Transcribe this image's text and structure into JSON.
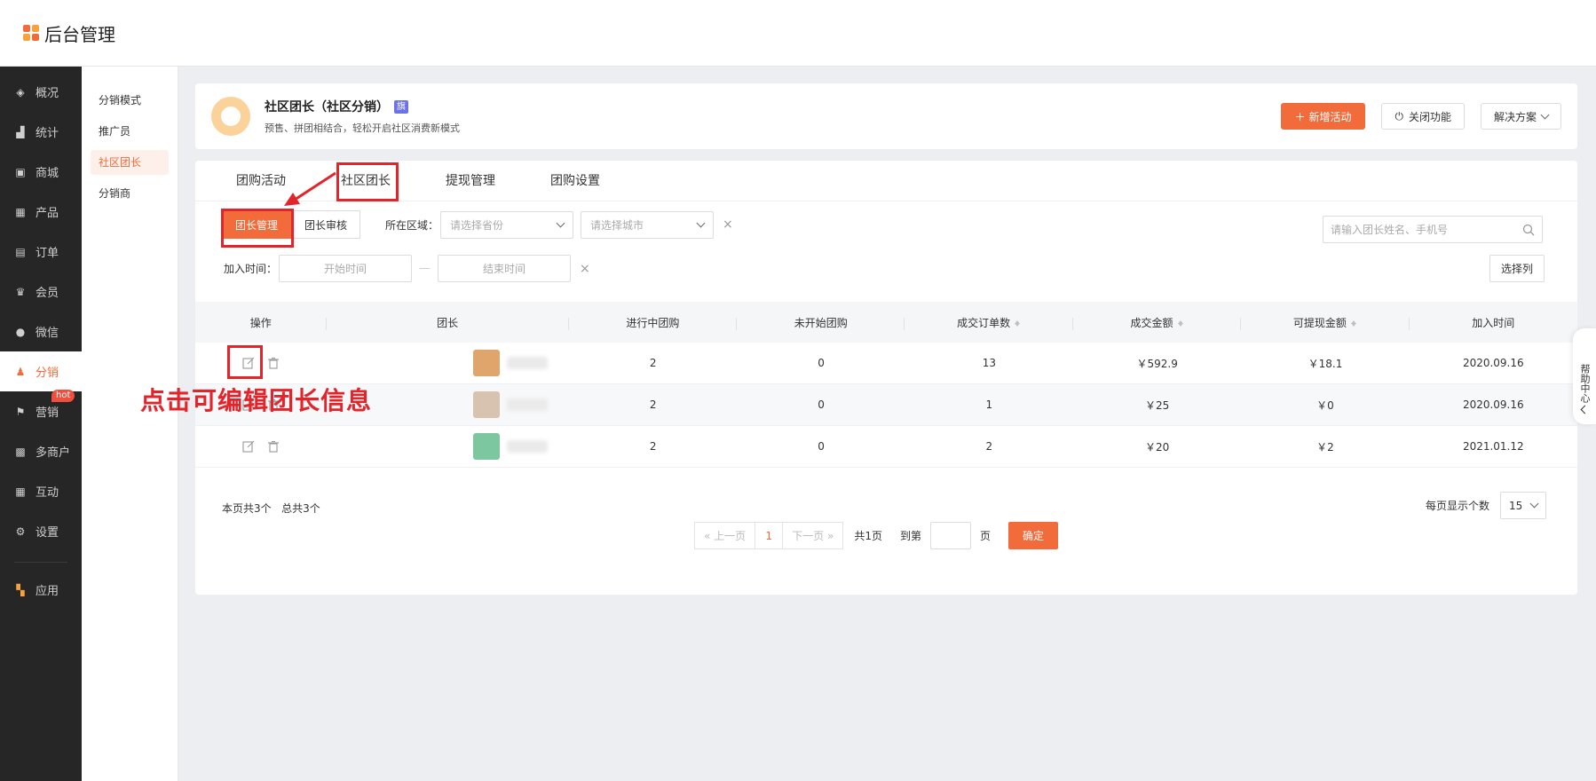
{
  "app": {
    "title": "后台管理"
  },
  "sidebar": {
    "items": [
      {
        "label": "概况",
        "icon": "layers-icon"
      },
      {
        "label": "统计",
        "icon": "chart-icon"
      },
      {
        "label": "商城",
        "icon": "shop-icon"
      },
      {
        "label": "产品",
        "icon": "grid-icon"
      },
      {
        "label": "订单",
        "icon": "clipboard-icon"
      },
      {
        "label": "会员",
        "icon": "crown-icon"
      },
      {
        "label": "微信",
        "icon": "wechat-icon"
      },
      {
        "label": "分销",
        "icon": "user-icon",
        "active": true
      },
      {
        "label": "营销",
        "icon": "flag-icon",
        "badge": "hot"
      },
      {
        "label": "多商户",
        "icon": "store-icon"
      },
      {
        "label": "互动",
        "icon": "apps-icon"
      },
      {
        "label": "设置",
        "icon": "gear-icon"
      },
      {
        "label": "应用",
        "icon": "app-grid-icon"
      }
    ]
  },
  "subnav": {
    "items": [
      "分销模式",
      "推广员",
      "社区团长",
      "分销商"
    ],
    "active_index": 2
  },
  "info": {
    "title": "社区团长（社区分销）",
    "badge": "旗",
    "desc": "预售、拼团相结合，轻松开启社区消费新模式",
    "btn_new": "＋ 新增活动",
    "btn_close": "关闭功能",
    "btn_solution": "解决方案"
  },
  "tabs": [
    "团购活动",
    "社区团长",
    "提现管理",
    "团购设置"
  ],
  "filters": {
    "seg_manage": "团长管理",
    "seg_review": "团长审核",
    "region_label": "所在区域：",
    "province_placeholder": "请选择省份",
    "city_placeholder": "请选择城市",
    "clear": "×",
    "search_placeholder": "请输入团长姓名、手机号",
    "time_label": "加入时间：",
    "start_time": "开始时间",
    "end_time": "结束时间",
    "time_sep": "—",
    "columns_button": "选择列"
  },
  "table": {
    "headers": [
      "操作",
      "团长",
      "进行中团购",
      "未开始团购",
      "成交订单数",
      "成交金额",
      "可提现金额",
      "加入时间"
    ],
    "rows": [
      {
        "ongoing": "2",
        "pending": "0",
        "orders": "13",
        "amount": "￥592.9",
        "withdrawable": "￥18.1",
        "joined": "2020.09.16",
        "thumb": "#e0a56b"
      },
      {
        "ongoing": "2",
        "pending": "0",
        "orders": "1",
        "amount": "￥25",
        "withdrawable": "￥0",
        "joined": "2020.09.16",
        "thumb": "#d8c3b0"
      },
      {
        "ongoing": "2",
        "pending": "0",
        "orders": "2",
        "amount": "￥20",
        "withdrawable": "￥2",
        "joined": "2021.01.12",
        "thumb": "#7cc7a0"
      }
    ]
  },
  "footer": {
    "count_text": "本页共3个   总共3个",
    "prev": "上一页",
    "page": "1",
    "next": "下一页",
    "total_pages": "共1页",
    "goto_label": "到第",
    "page_unit": "页",
    "confirm": "确定",
    "per_page_label": "每页显示个数",
    "per_page_value": "15"
  },
  "help": {
    "label": "帮助中心"
  },
  "annotation": {
    "text": "点击可编辑团长信息"
  },
  "colors": {
    "accent": "#f26b3a",
    "annotation": "#e3242b",
    "sidebar_bg": "#262626"
  }
}
